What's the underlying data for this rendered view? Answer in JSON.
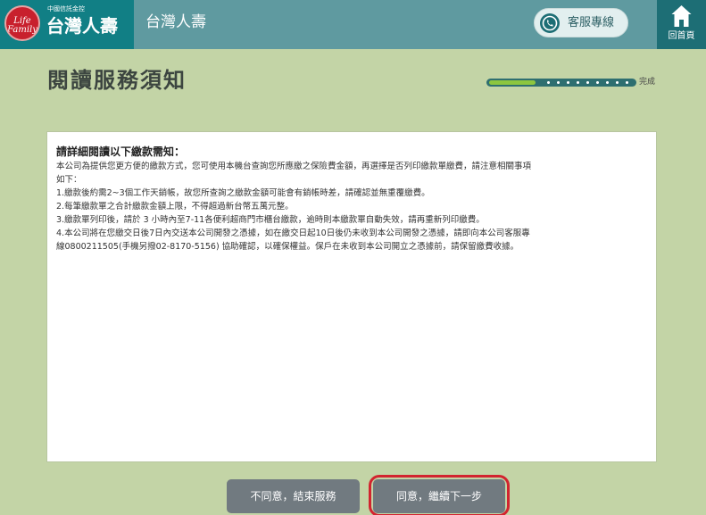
{
  "header": {
    "logo_text": "Life Family",
    "brand_small": "中國信託金控",
    "brand_name": "台灣人壽",
    "title": "台灣人壽",
    "service_label": "客服專線",
    "home_label": "回首頁",
    "icons": {
      "service": "phone-icon",
      "home": "home-icon"
    },
    "colors": {
      "header_bg": "#5f9aa0",
      "brand_bg": "#117f85",
      "logo_red": "#c8202d"
    }
  },
  "page": {
    "title": "閱讀服務須知",
    "progress_label": "完成",
    "progress_steps_total": 10,
    "progress_steps_done": 1,
    "background": "#c3d4a6"
  },
  "notice": {
    "heading": "請詳細閱讀以下繳款需知：",
    "lines": [
      "本公司為提供您更方便的繳款方式，您可使用本機台查詢您所應繳之保險費金額，再選擇是否列印繳款單繳費，請注意相關事項",
      "如下：",
      "1.繳款後約需2~3個工作天銷帳，故您所查詢之繳款金額可能會有銷帳時差，請確認並無重覆繳費。",
      "2.每筆繳款單之合計繳款金額上限，不得超過新台幣五萬元整。",
      "3.繳款單列印後，請於 3 小時內至7-11各便利超商門市櫃台繳款，逾時則本繳款單自動失效，請再重新列印繳費。",
      "4.本公司將在您繳交日後7日內交送本公司開發之憑據，如在繳交日起10日後仍未收到本公司開發之憑據，請即向本公司客服專",
      "  線0800211505(手機另撥02-8170-5156) 協助確認，以確保權益。保戶在未收到本公司開立之憑據前，請保留繳費收據。"
    ]
  },
  "actions": {
    "disagree_label": "不同意，結束服務",
    "agree_label": "同意，繼續下一步",
    "highlight_color": "#d2242f"
  }
}
